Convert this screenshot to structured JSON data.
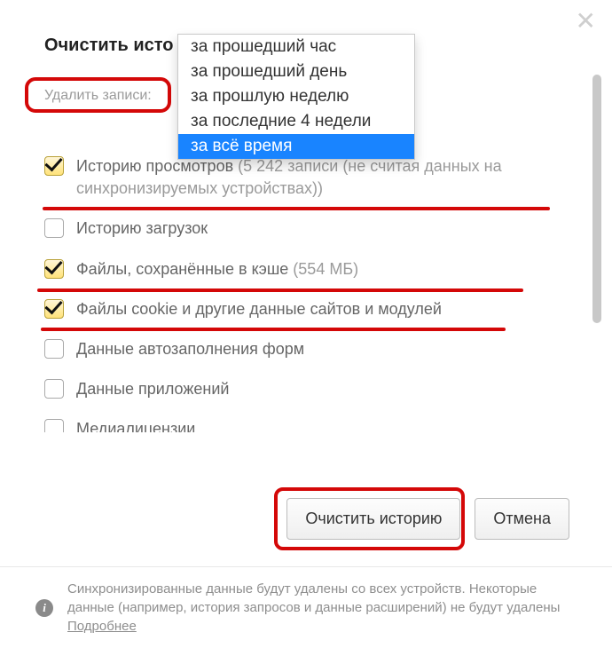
{
  "title": "Очистить исто",
  "delete_records_label": "Удалить записи:",
  "dropdown": {
    "options": [
      "за прошедший час",
      "за прошедший день",
      "за прошлую неделю",
      "за последние 4 недели",
      "за всё время"
    ],
    "selected_index": 4
  },
  "checkboxes": {
    "views_history": {
      "checked": true,
      "label": "Историю просмотров ",
      "muted": "(5 242 записи (не считая данных на синхронизируемых устройствах))"
    },
    "downloads_history": {
      "checked": false,
      "label": "Историю загрузок"
    },
    "cached_files": {
      "checked": true,
      "label": "Файлы, сохранённые в кэше ",
      "muted": "(554 МБ)"
    },
    "cookies": {
      "checked": true,
      "label": "Файлы cookie и другие данные сайтов и модулей"
    },
    "autofill": {
      "checked": false,
      "label": "Данные автозаполнения форм"
    },
    "app_data": {
      "checked": false,
      "label": "Данные приложений"
    },
    "media": {
      "checked": false,
      "label": "Медиалицензии"
    }
  },
  "buttons": {
    "clear": "Очистить историю",
    "cancel": "Отмена"
  },
  "footer": {
    "text": "Синхронизированные данные будут удалены со всех устройств. Некоторые данные (например, история запросов и данные расширений) не будут удалены ",
    "link": "Подробнее"
  },
  "annotations": {
    "color": "#d40808"
  }
}
